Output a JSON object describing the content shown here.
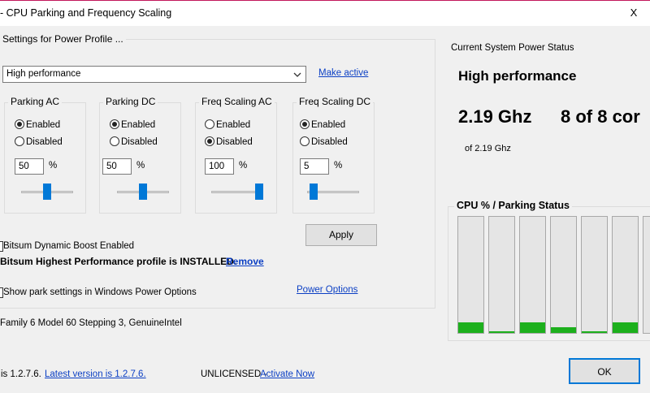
{
  "window": {
    "title": "- CPU Parking and Frequency Scaling",
    "close_glyph": "X"
  },
  "settings": {
    "group_label": "Settings for Power Profile ...",
    "profile_selected": "High performance",
    "make_active_label": "Make active",
    "columns": [
      {
        "title": "Parking AC",
        "enabled_label": "Enabled",
        "disabled_label": "Disabled",
        "selected": "enabled",
        "value": "50",
        "unit": "%",
        "slider_percent": 50
      },
      {
        "title": "Parking DC",
        "enabled_label": "Enabled",
        "disabled_label": "Disabled",
        "selected": "enabled",
        "value": "50",
        "unit": "%",
        "slider_percent": 50
      },
      {
        "title": "Freq Scaling AC",
        "enabled_label": "Enabled",
        "disabled_label": "Disabled",
        "selected": "disabled",
        "value": "100",
        "unit": "%",
        "slider_percent": 100
      },
      {
        "title": "Freq Scaling DC",
        "enabled_label": "Enabled",
        "disabled_label": "Disabled",
        "selected": "enabled",
        "value": "5",
        "unit": "%",
        "slider_percent": 5
      }
    ],
    "apply_label": "Apply",
    "dynamic_boost_label": "Bitsum Dynamic Boost Enabled",
    "profile_installed_text": "Bitsum Highest Performance profile is INSTALLED.",
    "remove_label": "Remove",
    "show_park_label": "Show park settings in Windows Power Options",
    "power_options_label": "Power Options",
    "cpu_info": "Family 6 Model 60 Stepping 3, GenuineIntel"
  },
  "status": {
    "label": "Current System Power Status",
    "profile": "High performance",
    "frequency": "2.19 Ghz",
    "cores": "8 of 8 cor",
    "sub_frequency": "of 2.19 Ghz",
    "cpu_group_label": "CPU % / Parking Status",
    "cpu_bars": [
      0.09,
      0.01,
      0.09,
      0.05,
      0.01,
      0.09,
      0.0
    ]
  },
  "footer": {
    "version_text": "is 1.2.7.6.",
    "latest_version_label": "Latest version is 1.2.7.6.",
    "license_text": "UNLICENSED -",
    "activate_label": "Activate Now",
    "ok_label": "OK"
  },
  "colors": {
    "accent": "#0078d7",
    "link": "#0b3fc4",
    "bar_fill": "#1db01d",
    "titlebar_border": "#c2185b"
  }
}
